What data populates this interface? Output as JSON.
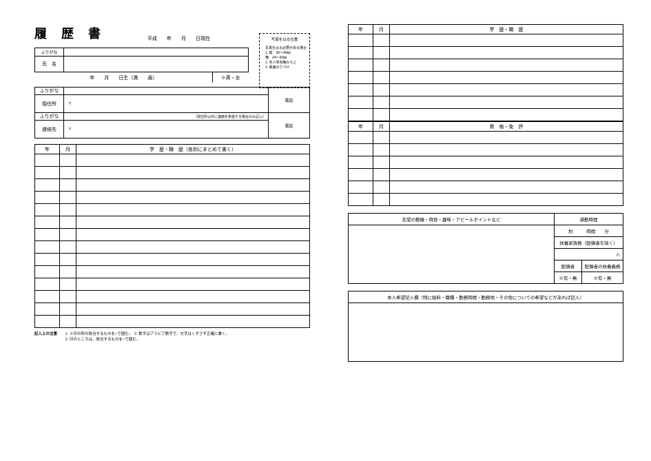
{
  "title": "履 歴 書",
  "asof_label": "平成　　年　　月　　日現在",
  "photo_note": {
    "title": "写真をはる位置",
    "lines": [
      "写真をはる必要がある場合",
      "1. 縦　36～40㎜",
      "   横　24～30㎜",
      "2. 本人単身胸から上",
      "3. 裏面のりづけ"
    ]
  },
  "left": {
    "furigana_label": "ふりがな",
    "name_label": "氏　名",
    "dob_label": "年　　月　　日生（満　　歳）",
    "gender_label": "※男・女",
    "addr_furi_label": "ふりがな",
    "addr_label": "現住所",
    "tel_label": "電話",
    "contact_label": "連絡先",
    "contact_note": "（現住所以外に連絡を希望する場合のみ記入）",
    "grid_header": {
      "year": "年",
      "month": "月",
      "title": "学　歴・職　歴（各別にまとめて書く）"
    },
    "grid_rows": 14,
    "footnote_label": "記入上の注意",
    "footnotes": [
      "※印の所の該当するものを○で囲む。　2. 数字はアラビア数字で、文字はくずさず正確に書く。",
      "印のところは、該当するものを○で囲む。"
    ]
  },
  "right": {
    "grid1_header": {
      "year": "年",
      "month": "月",
      "title": "学　歴・職　歴"
    },
    "grid1_rows": 7,
    "grid2_header": {
      "year": "年",
      "month": "月",
      "title": "資　格・免　許"
    },
    "grid2_rows": 6,
    "box1": {
      "left_header": "志望の動機・特技・趣味・アピールポイントなど",
      "right_header": "通勤時間",
      "commute_value": "約　　　時間　　分",
      "dependents_label": "扶養家族数（配偶者を除く）",
      "dependents_unit": "人",
      "spouse_label": "配偶者",
      "spouse_opt": "※有・無",
      "spouse_dep_label": "配偶者の扶養義務",
      "spouse_dep_opt": "※有・無"
    },
    "box2": {
      "header": "本人希望記入欄（特に給料・職種・勤務時間・勤務地・その他についての希望などがあれば記入）"
    }
  },
  "postal_mark": "〒"
}
